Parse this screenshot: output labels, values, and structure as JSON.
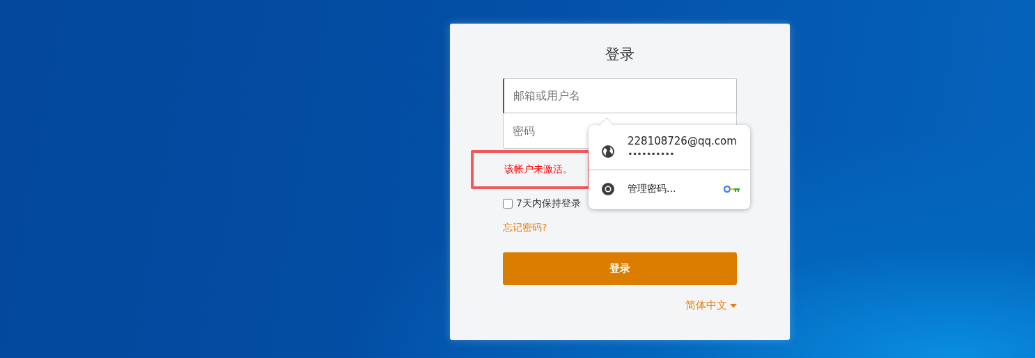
{
  "title": "登录",
  "fields": [
    {
      "placeholder": "邮箱或用户名",
      "focused": true
    },
    {
      "placeholder": "密码",
      "focused": false
    }
  ],
  "error": {
    "message": "该帐户未激活。",
    "highlighted": true
  },
  "remember": {
    "label": "7天内保持登录",
    "checked": false
  },
  "forgot_link": "忘记密码?",
  "login_button": "登录",
  "language": "简体中文",
  "autofill_popup": {
    "accounts": [
      {
        "username": "228108726@qq.com",
        "password": "••••••••••"
      }
    ],
    "manage_label": "管理密码..."
  }
}
